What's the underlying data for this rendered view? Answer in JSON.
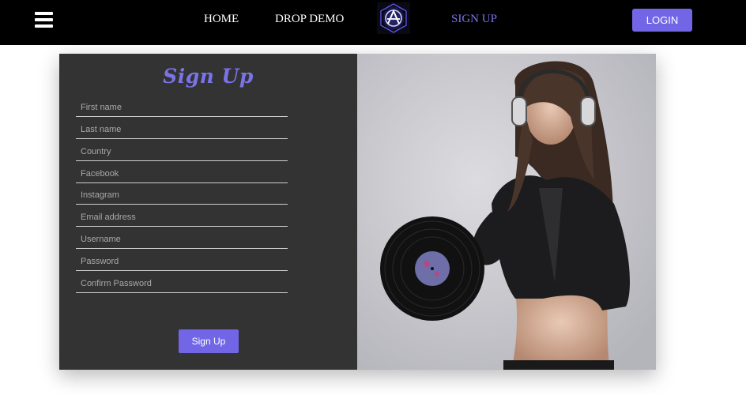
{
  "nav": {
    "home": "HOME",
    "drop_demo": "DROP DEMO",
    "sign_up": "SIGN UP",
    "login": "LOGIN",
    "active_color": "#7b73e8"
  },
  "form": {
    "title": "Sign Up",
    "fields": {
      "first_name": "First name",
      "last_name": "Last name",
      "country": "Country",
      "facebook": "Facebook",
      "instagram": "Instagram",
      "email": "Email address",
      "username": "Username",
      "password": "Password",
      "confirm_password": "Confirm Password"
    },
    "submit": "Sign Up"
  },
  "colors": {
    "accent": "#7366e6",
    "panel": "#333333",
    "topbar": "#000000"
  },
  "icons": [
    "hamburger-menu-icon",
    "brand-logo",
    "dj-photo"
  ]
}
